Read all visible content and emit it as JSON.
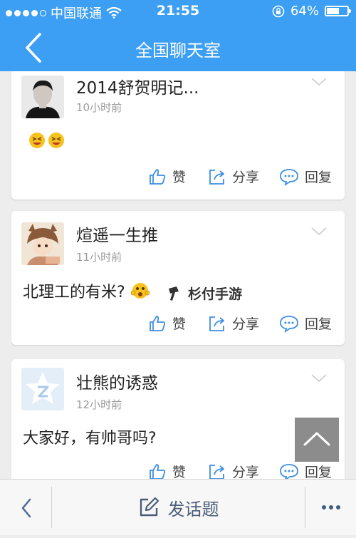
{
  "status_bar": {
    "carrier": "中国联通",
    "time": "21:55",
    "battery": "64%",
    "battery_level": 0.64
  },
  "header": {
    "title": "全国聊天室",
    "back_icon": "chevron-left-icon"
  },
  "colors": {
    "header_bg": "#3d9ff3",
    "action_icon": "#3e8ee4",
    "muted_text": "#9a9a9a",
    "bottom_accent": "#4a5d78"
  },
  "posts": [
    {
      "username": "2014舒贺明记...",
      "time": "10小时前",
      "content": "",
      "emoji": "grinning-squint-emoji",
      "actions": {
        "like": "赞",
        "share": "分享",
        "reply": "回复"
      }
    },
    {
      "username": "煊遥一生推",
      "time": "11小时前",
      "content": "北理工的有米?",
      "emoji": "surprised-emoji",
      "actions": {
        "like": "赞",
        "share": "分享",
        "reply": "回复"
      }
    },
    {
      "username": "壮熊的诱惑",
      "time": "12小时前",
      "content": "大家好，有帅哥吗?",
      "actions": {
        "like": "赞",
        "share": "分享",
        "reply": "回复"
      }
    }
  ],
  "watermark": "杉付手游",
  "bottom_bar": {
    "post_label": "发话题",
    "back_icon": "chevron-left-icon",
    "more_icon": "ellipsis-icon"
  }
}
